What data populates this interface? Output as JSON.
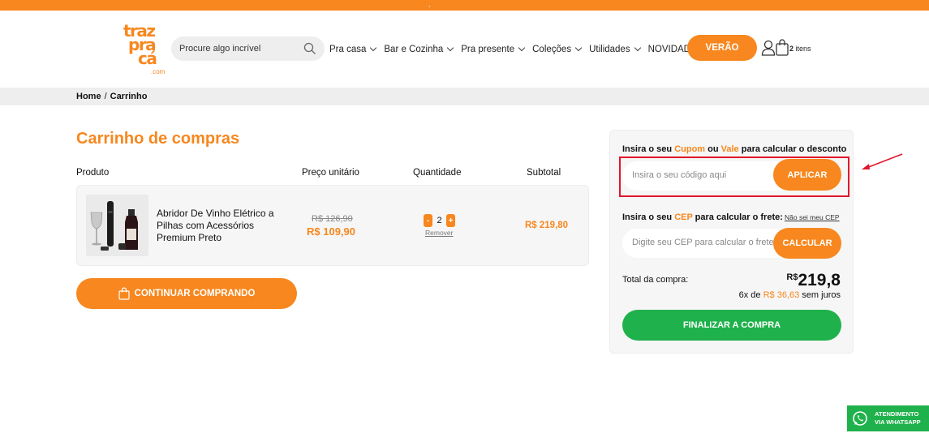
{
  "topbar": {
    "text": ","
  },
  "logo": {
    "line1": "traz",
    "line2": "pra",
    "line3": "cá",
    "line4": ".com"
  },
  "search": {
    "placeholder": "Procure algo incrível"
  },
  "nav": {
    "items": [
      {
        "label": "Pra casa",
        "has_dropdown": true
      },
      {
        "label": "Bar e Cozinha",
        "has_dropdown": true
      },
      {
        "label": "Pra presente",
        "has_dropdown": true
      },
      {
        "label": "Coleções",
        "has_dropdown": true
      },
      {
        "label": "Utilidades",
        "has_dropdown": true
      },
      {
        "label": "NOVIDADES",
        "has_dropdown": false
      }
    ],
    "verao_label": "VERÃO"
  },
  "cart": {
    "count": "2",
    "suffix": "itens"
  },
  "breadcrumb": {
    "home": "Home",
    "separator": "/",
    "current": "Carrinho"
  },
  "page_title": "Carrinho de compras",
  "table_headers": {
    "product": "Produto",
    "unit_price": "Preço unitário",
    "quantity": "Quantidade",
    "subtotal": "Subtotal"
  },
  "item": {
    "name": "Abridor De Vinho Elétrico a Pilhas com Acessórios Premium Preto",
    "old_price": "R$ 126,90",
    "price": "R$ 109,90",
    "minus": "-",
    "quantity": "2",
    "plus": "+",
    "remove": "Remover",
    "subtotal": "R$ 219,80"
  },
  "continue_button": "CONTINUAR COMPRANDO",
  "summary": {
    "coupon_label_1": "Insira o seu ",
    "coupon_cupom": "Cupom",
    "coupon_label_2": " ou ",
    "coupon_vale": "Vale",
    "coupon_label_3": " para calcular o desconto",
    "coupon_placeholder": "Insira o seu código aqui",
    "apply_button": "APLICAR",
    "cep_label_1": "Insira o seu ",
    "cep_cep": "CEP",
    "cep_label_2": " para calcular o frete:",
    "dont_know_cep": "Não sei meu CEP",
    "cep_placeholder": "Digite seu CEP para calcular o frete",
    "calc_button": "CALCULAR",
    "total_label": "Total da compra:",
    "total_currency": "R$",
    "total_value": "219,8",
    "installments_prefix": "6x de ",
    "installments_value": "R$ 36,63",
    "installments_suffix": " sem juros",
    "finish_button": "FINALIZAR A COMPRA"
  },
  "whatsapp": {
    "line1": "ATENDIMENTO",
    "line2": "VIA WHATSAPP"
  },
  "colors": {
    "brand_orange": "#f7871e",
    "green": "#1fb14b",
    "highlight_red": "#e0162b"
  }
}
